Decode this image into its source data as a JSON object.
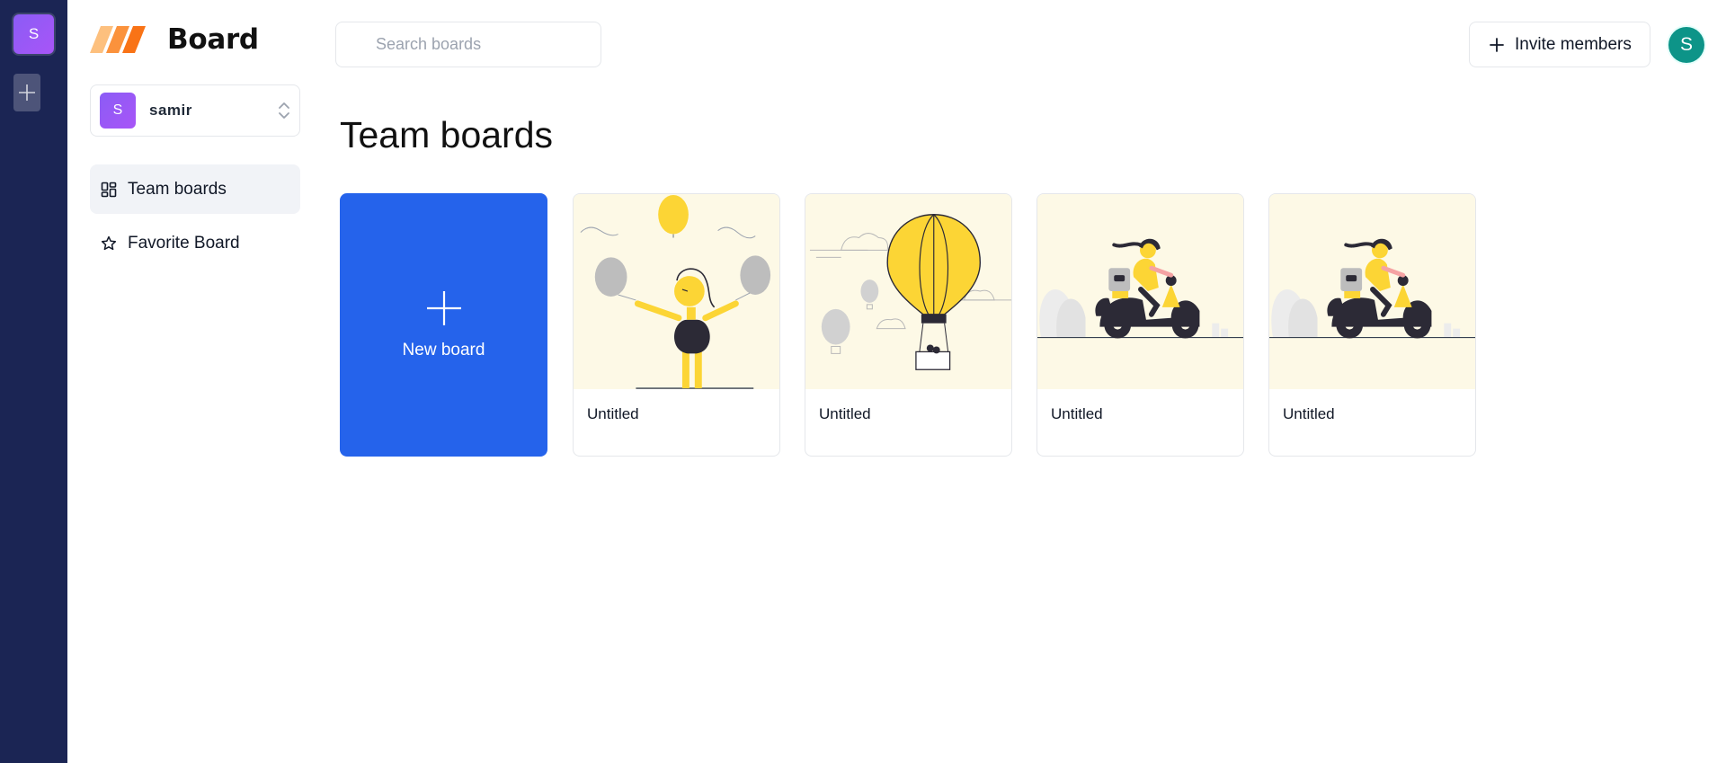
{
  "org_rail": {
    "active_org_initial": "S",
    "accent": "#1b2554"
  },
  "sidebar": {
    "logo_text": "Board",
    "org_switcher": {
      "initial": "S",
      "name": "samir"
    },
    "nav": [
      {
        "label": "Team boards",
        "icon": "dashboard-icon",
        "active": true
      },
      {
        "label": "Favorite Board",
        "icon": "star-icon",
        "active": false
      }
    ]
  },
  "header": {
    "search_placeholder": "Search boards",
    "invite_label": "Invite members",
    "user_initial": "S"
  },
  "main": {
    "title": "Team boards",
    "new_board_label": "New board",
    "boards": [
      {
        "title": "Untitled",
        "illustration": "person-with-balloons"
      },
      {
        "title": "Untitled",
        "illustration": "hot-air-balloon"
      },
      {
        "title": "Untitled",
        "illustration": "scooter-rider"
      },
      {
        "title": "Untitled",
        "illustration": "scooter-rider"
      }
    ]
  },
  "colors": {
    "primary": "#2563eb",
    "rail": "#1b2554",
    "org_avatar": "#8b5cf6",
    "user_avatar": "#0d9488",
    "card_art_bg": "#fdf9e6",
    "illustration_yellow": "#fcd535"
  }
}
